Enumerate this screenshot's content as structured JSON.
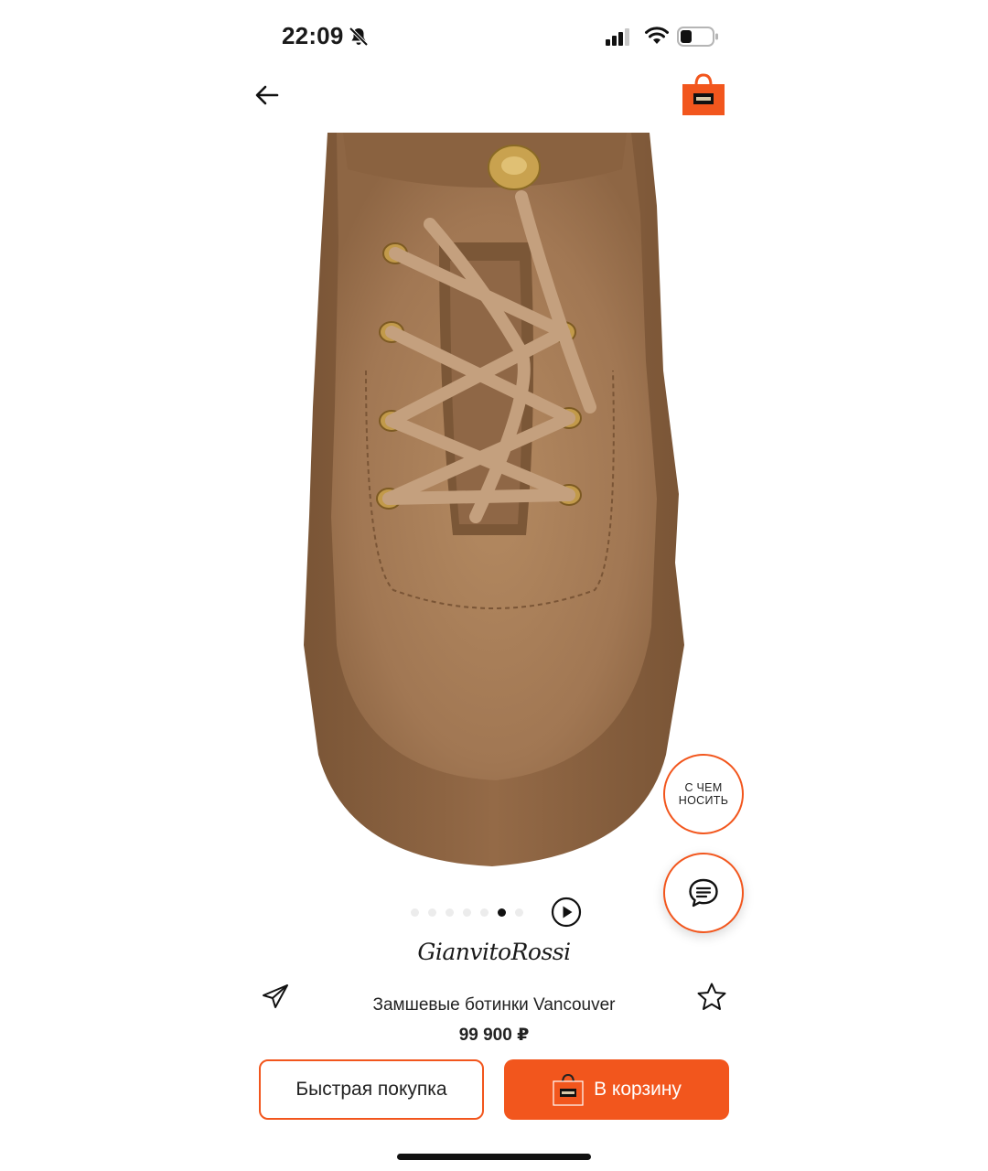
{
  "status_bar": {
    "time": "22:09",
    "icons": [
      "bell-muted-icon",
      "signal-icon",
      "wifi-icon",
      "battery-icon"
    ]
  },
  "nav": {
    "back_icon": "arrow-left-icon",
    "bag_icon": "shopping-bag-icon"
  },
  "gallery": {
    "image_subject": "suede lace-up boot, top view",
    "dots_total": 7,
    "active_dot_index": 5,
    "play_icon": "play-circle-icon"
  },
  "fab": {
    "outfit_label": "С ЧЕМ НОСИТЬ",
    "chat_icon": "chat-bubble-icon"
  },
  "product": {
    "brand": "GianvitoRossi",
    "title": "Замшевые ботинки Vancouver",
    "price": "99 900 ₽",
    "share_icon": "send-icon",
    "favorite_icon": "star-outline-icon"
  },
  "actions": {
    "quick_buy": "Быстрая покупка",
    "add_to_cart": "В корзину"
  },
  "colors": {
    "accent": "#f2561d",
    "text": "#1a1a1a",
    "suede": "#a67c55",
    "sole": "#8b6443"
  }
}
